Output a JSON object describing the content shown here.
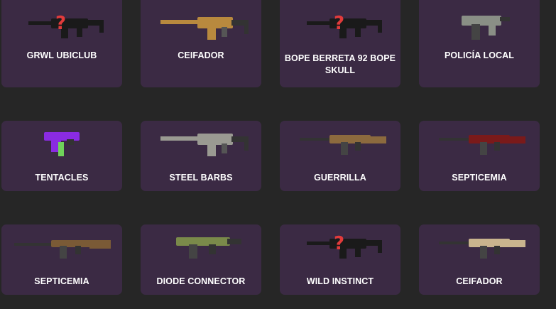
{
  "items": [
    {
      "name": "GRWL UBICLUB",
      "unknown": true,
      "weapon": "smg",
      "color": "#111111"
    },
    {
      "name": "CEIFADOR",
      "unknown": false,
      "weapon": "shotgun",
      "color": "#b8893e"
    },
    {
      "name": "BOPE BERRETA 92 BOPE SKULL",
      "unknown": true,
      "weapon": "smg",
      "color": "#111111"
    },
    {
      "name": "POLICÍA LOCAL",
      "unknown": false,
      "weapon": "pistol-smg",
      "color": "#8a8f86"
    },
    {
      "name": "TENTACLES",
      "unknown": false,
      "weapon": "pistol",
      "color": "#8a2be2"
    },
    {
      "name": "STEEL BARBS",
      "unknown": false,
      "weapon": "shotgun",
      "color": "#9a9a92"
    },
    {
      "name": "GUERRILLA",
      "unknown": false,
      "weapon": "rifle",
      "color": "#8c6a3e"
    },
    {
      "name": "SEPTICEMIA",
      "unknown": false,
      "weapon": "rifle",
      "color": "#7a1a1a"
    },
    {
      "name": "SEPTICEMIA",
      "unknown": false,
      "weapon": "long-rifle",
      "color": "#7a5a36"
    },
    {
      "name": "DIODE CONNECTOR",
      "unknown": false,
      "weapon": "smg-drum",
      "color": "#7a8a4a"
    },
    {
      "name": "WILD INSTINCT",
      "unknown": true,
      "weapon": "smg",
      "color": "#111111"
    },
    {
      "name": "CEIFADOR",
      "unknown": false,
      "weapon": "rifle",
      "color": "#c9b48e"
    }
  ],
  "unknown_glyph": "?",
  "unknown_color": "#e23b3b",
  "card_color": "#3b2a44",
  "page_background": "#262626"
}
